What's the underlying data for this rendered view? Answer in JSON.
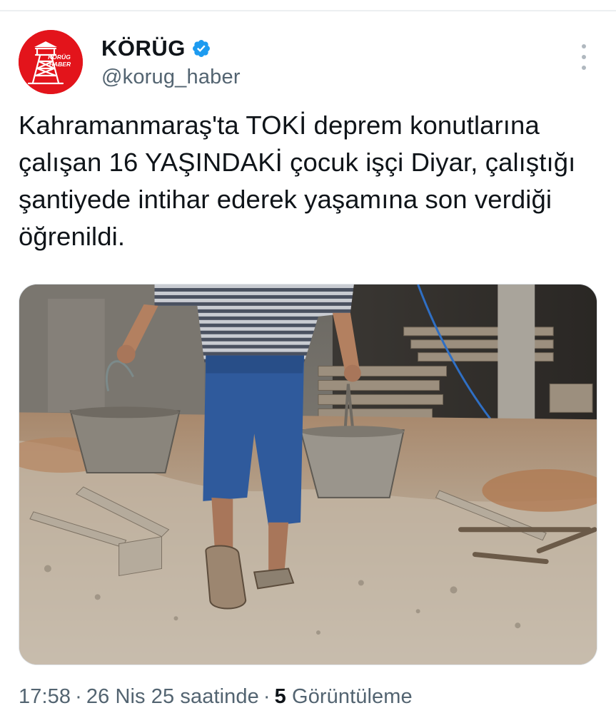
{
  "account": {
    "display_name": "KÖRÜG",
    "handle": "@korug_haber",
    "verified_icon": "verified-badge-icon",
    "avatar_text_line1": "KÖRÜG",
    "avatar_text_line2": "HABER",
    "avatar_color": "#e3141b"
  },
  "tweet": {
    "text": "Kahramanmaraş'ta TOKİ deprem konutlarına çalışan 16 YAŞINDAKİ çocuk işçi Diyar, çalıştığı şantiyede intihar ederek yaşamına son verdiği öğrenildi."
  },
  "meta": {
    "time": "17:58",
    "separator": "·",
    "date": "26 Nis 25 saatinde",
    "views_count": "5",
    "views_label": "Görüntüleme"
  },
  "colors": {
    "text_primary": "#0f1419",
    "text_secondary": "#536471",
    "verified_blue": "#1d9bf0"
  }
}
